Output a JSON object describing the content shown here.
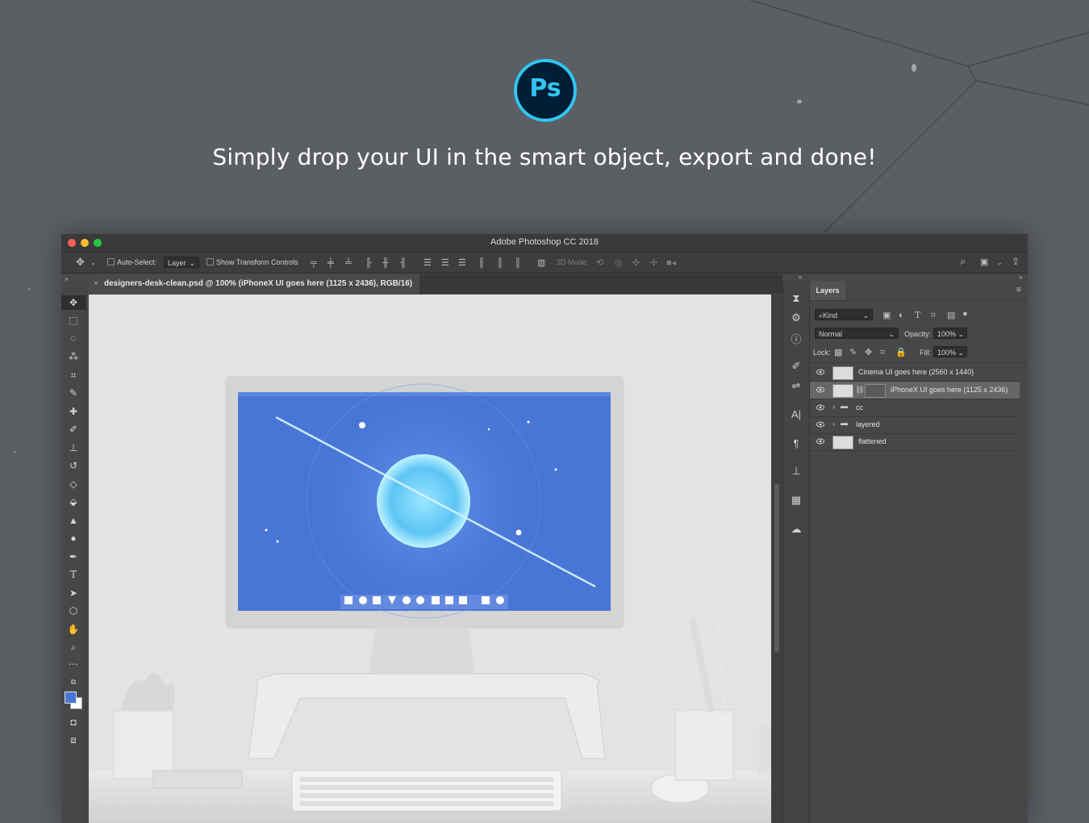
{
  "hero": {
    "logo_text": "Ps",
    "headline": "Simply drop your UI in the smart object, export and done!"
  },
  "colors": {
    "background": "#5b5e63",
    "ps_logo_fill": "#001e36",
    "ps_logo_accent": "#31c5f0",
    "window_bg": "#474747",
    "screen_blue": "#4876d6",
    "canvas_bg": "#e3e3e3"
  },
  "window": {
    "title": "Adobe Photoshop CC 2018",
    "traffic_lights": [
      "close",
      "minimize",
      "zoom"
    ]
  },
  "options_bar": {
    "move_tool_icon": "move-icon",
    "auto_select_label": "Auto-Select:",
    "auto_select_value": "Layer",
    "show_transform_label": "Show Transform Controls",
    "mode_3d_label": "3D Mode:"
  },
  "document": {
    "tab_title": "designers-desk-clean.psd @ 100% (iPhoneX UI goes here (1125 x 2436), RGB/16)"
  },
  "tools": [
    "move-icon",
    "marquee-icon",
    "lasso-icon",
    "magic-wand-icon",
    "crop-icon",
    "eyedropper-icon",
    "healing-brush-icon",
    "brush-icon",
    "stamp-icon",
    "history-brush-icon",
    "eraser-icon",
    "paint-bucket-icon",
    "blur-icon",
    "dodge-icon",
    "pen-icon",
    "type-icon",
    "path-selection-icon",
    "shape-icon",
    "hand-icon",
    "zoom-icon",
    "more-icon"
  ],
  "layers_panel": {
    "tab_label": "Layers",
    "filter_label": "Kind",
    "blend_mode": "Normal",
    "opacity_label": "Opacity:",
    "opacity_value": "100%",
    "lock_label": "Lock:",
    "fill_label": "Fill:",
    "fill_value": "100%",
    "layers": [
      {
        "name": "Cinema UI goes here (2560 x 1440)",
        "type": "smart-object",
        "selected": false
      },
      {
        "name": "iPhoneX UI goes here (1125 x 2436)",
        "type": "smart-object",
        "selected": true
      },
      {
        "name": "cc",
        "type": "group",
        "selected": false
      },
      {
        "name": "layered",
        "type": "group",
        "selected": false
      },
      {
        "name": "flattened",
        "type": "pixel",
        "selected": false
      }
    ]
  }
}
